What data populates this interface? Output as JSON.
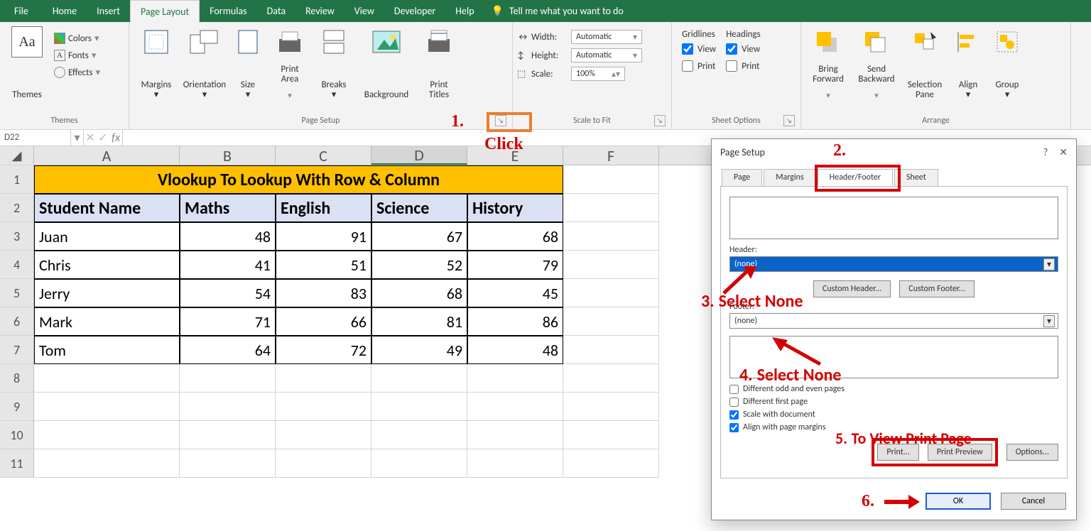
{
  "tabs": {
    "file": "File",
    "home": "Home",
    "insert": "Insert",
    "pagelayout": "Page Layout",
    "formulas": "Formulas",
    "data": "Data",
    "review": "Review",
    "view": "View",
    "developer": "Developer",
    "help": "Help",
    "tellme": "Tell me what you want to do"
  },
  "ribbon": {
    "themes": {
      "label": "Themes",
      "themesBtn": "Themes",
      "colors": "Colors",
      "fonts": "Fonts",
      "effects": "Effects"
    },
    "pagesetup": {
      "label": "Page Setup",
      "margins": "Margins",
      "orientation": "Orientation",
      "size": "Size",
      "printarea": "Print\nArea",
      "breaks": "Breaks",
      "background": "Background",
      "printtitles": "Print\nTitles"
    },
    "scale": {
      "label": "Scale to Fit",
      "width": "Width:",
      "height": "Height:",
      "scale": "Scale:",
      "auto": "Automatic",
      "pct": "100%"
    },
    "sheet": {
      "label": "Sheet Options",
      "gridlines": "Gridlines",
      "headings": "Headings",
      "view": "View",
      "print": "Print"
    },
    "arrange": {
      "label": "Arrange",
      "bring": "Bring\nForward",
      "send": "Send\nBackward",
      "selpane": "Selection\nPane",
      "align": "Align",
      "group": "Group"
    }
  },
  "nameBox": "D22",
  "colHeaders": [
    "A",
    "B",
    "C",
    "D",
    "E",
    "F"
  ],
  "rows": [
    "1",
    "2",
    "3",
    "4",
    "5",
    "6",
    "7",
    "8",
    "9",
    "10",
    "11"
  ],
  "sheet": {
    "title": "Vlookup To Lookup With Row & Column",
    "headers": [
      "Student Name",
      "Maths",
      "English",
      "Science",
      "History"
    ],
    "data": [
      {
        "name": "Juan",
        "vals": [
          48,
          91,
          67,
          68
        ]
      },
      {
        "name": "Chris",
        "vals": [
          41,
          51,
          52,
          79
        ]
      },
      {
        "name": "Jerry",
        "vals": [
          54,
          83,
          68,
          45
        ]
      },
      {
        "name": "Mark",
        "vals": [
          71,
          66,
          81,
          86
        ]
      },
      {
        "name": "Tom",
        "vals": [
          64,
          72,
          49,
          48
        ]
      }
    ]
  },
  "dlg": {
    "title": "Page Setup",
    "tabs": {
      "page": "Page",
      "margins": "Margins",
      "hf": "Header/Footer",
      "sheet": "Sheet"
    },
    "header": "Header:",
    "none": "(none)",
    "customH": "Custom Header...",
    "customF": "Custom Footer...",
    "footer": "Footer:",
    "diffodd": "Different odd and even pages",
    "difffirst": "Different first page",
    "scaledoc": "Scale with document",
    "alignmar": "Align with page margins",
    "print": "Print...",
    "preview": "Print Preview",
    "options": "Options...",
    "ok": "OK",
    "cancel": "Cancel"
  },
  "anno": {
    "a1": "1.",
    "click": "Click",
    "a2": "2.",
    "a3": "3.",
    "seln": "Select None",
    "a4": "4.",
    "a5": "5.",
    "viewpp": "To View Print Page",
    "a6": "6."
  }
}
